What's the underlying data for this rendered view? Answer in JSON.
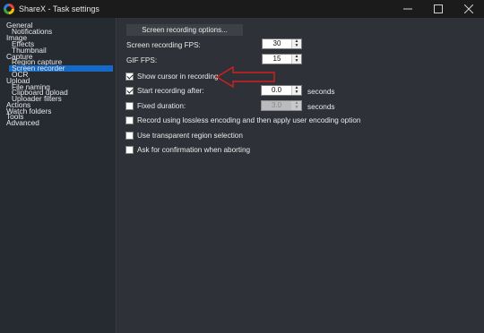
{
  "window": {
    "app_name": "ShareX",
    "separator": "-",
    "title": "Task settings",
    "controls": {
      "minimize": "minimize-icon",
      "maximize": "maximize-icon",
      "close": "close-icon"
    }
  },
  "sidebar": {
    "items": [
      {
        "label": "General",
        "level": 0
      },
      {
        "label": "Notifications",
        "level": 1
      },
      {
        "label": "Image",
        "level": 0
      },
      {
        "label": "Effects",
        "level": 1
      },
      {
        "label": "Thumbnail",
        "level": 1
      },
      {
        "label": "Capture",
        "level": 0
      },
      {
        "label": "Region capture",
        "level": 1
      },
      {
        "label": "Screen recorder",
        "level": 1,
        "selected": true
      },
      {
        "label": "OCR",
        "level": 1
      },
      {
        "label": "Upload",
        "level": 0
      },
      {
        "label": "File naming",
        "level": 1
      },
      {
        "label": "Clipboard upload",
        "level": 1
      },
      {
        "label": "Uploader filters",
        "level": 1
      },
      {
        "label": "Actions",
        "level": 0
      },
      {
        "label": "Watch folders",
        "level": 0
      },
      {
        "label": "Tools",
        "level": 0
      },
      {
        "label": "Advanced",
        "level": 0
      }
    ]
  },
  "main": {
    "options_button": "Screen recording options...",
    "fps": {
      "label": "Screen recording FPS:",
      "value": "30"
    },
    "gif_fps": {
      "label": "GIF FPS:",
      "value": "15"
    },
    "show_cursor": {
      "label": "Show cursor in recording",
      "checked": true
    },
    "start_after": {
      "label": "Start recording after:",
      "checked": true,
      "value": "0.0",
      "unit": "seconds"
    },
    "fixed_duration": {
      "label": "Fixed duration:",
      "checked": false,
      "value": "3.0",
      "unit": "seconds",
      "disabled": true
    },
    "lossless": {
      "label": "Record using lossless encoding and then apply user encoding option",
      "checked": false
    },
    "transparent": {
      "label": "Use transparent region selection",
      "checked": false
    },
    "confirm_abort": {
      "label": "Ask for confirmation when aborting",
      "checked": false
    }
  },
  "annotation": {
    "arrow_color": "#d42020"
  },
  "colors": {
    "accent": "#1569c7",
    "sidebar_bg": "#262a31",
    "panel_bg": "#2e3137",
    "titlebar_bg": "#1b1b1b"
  }
}
